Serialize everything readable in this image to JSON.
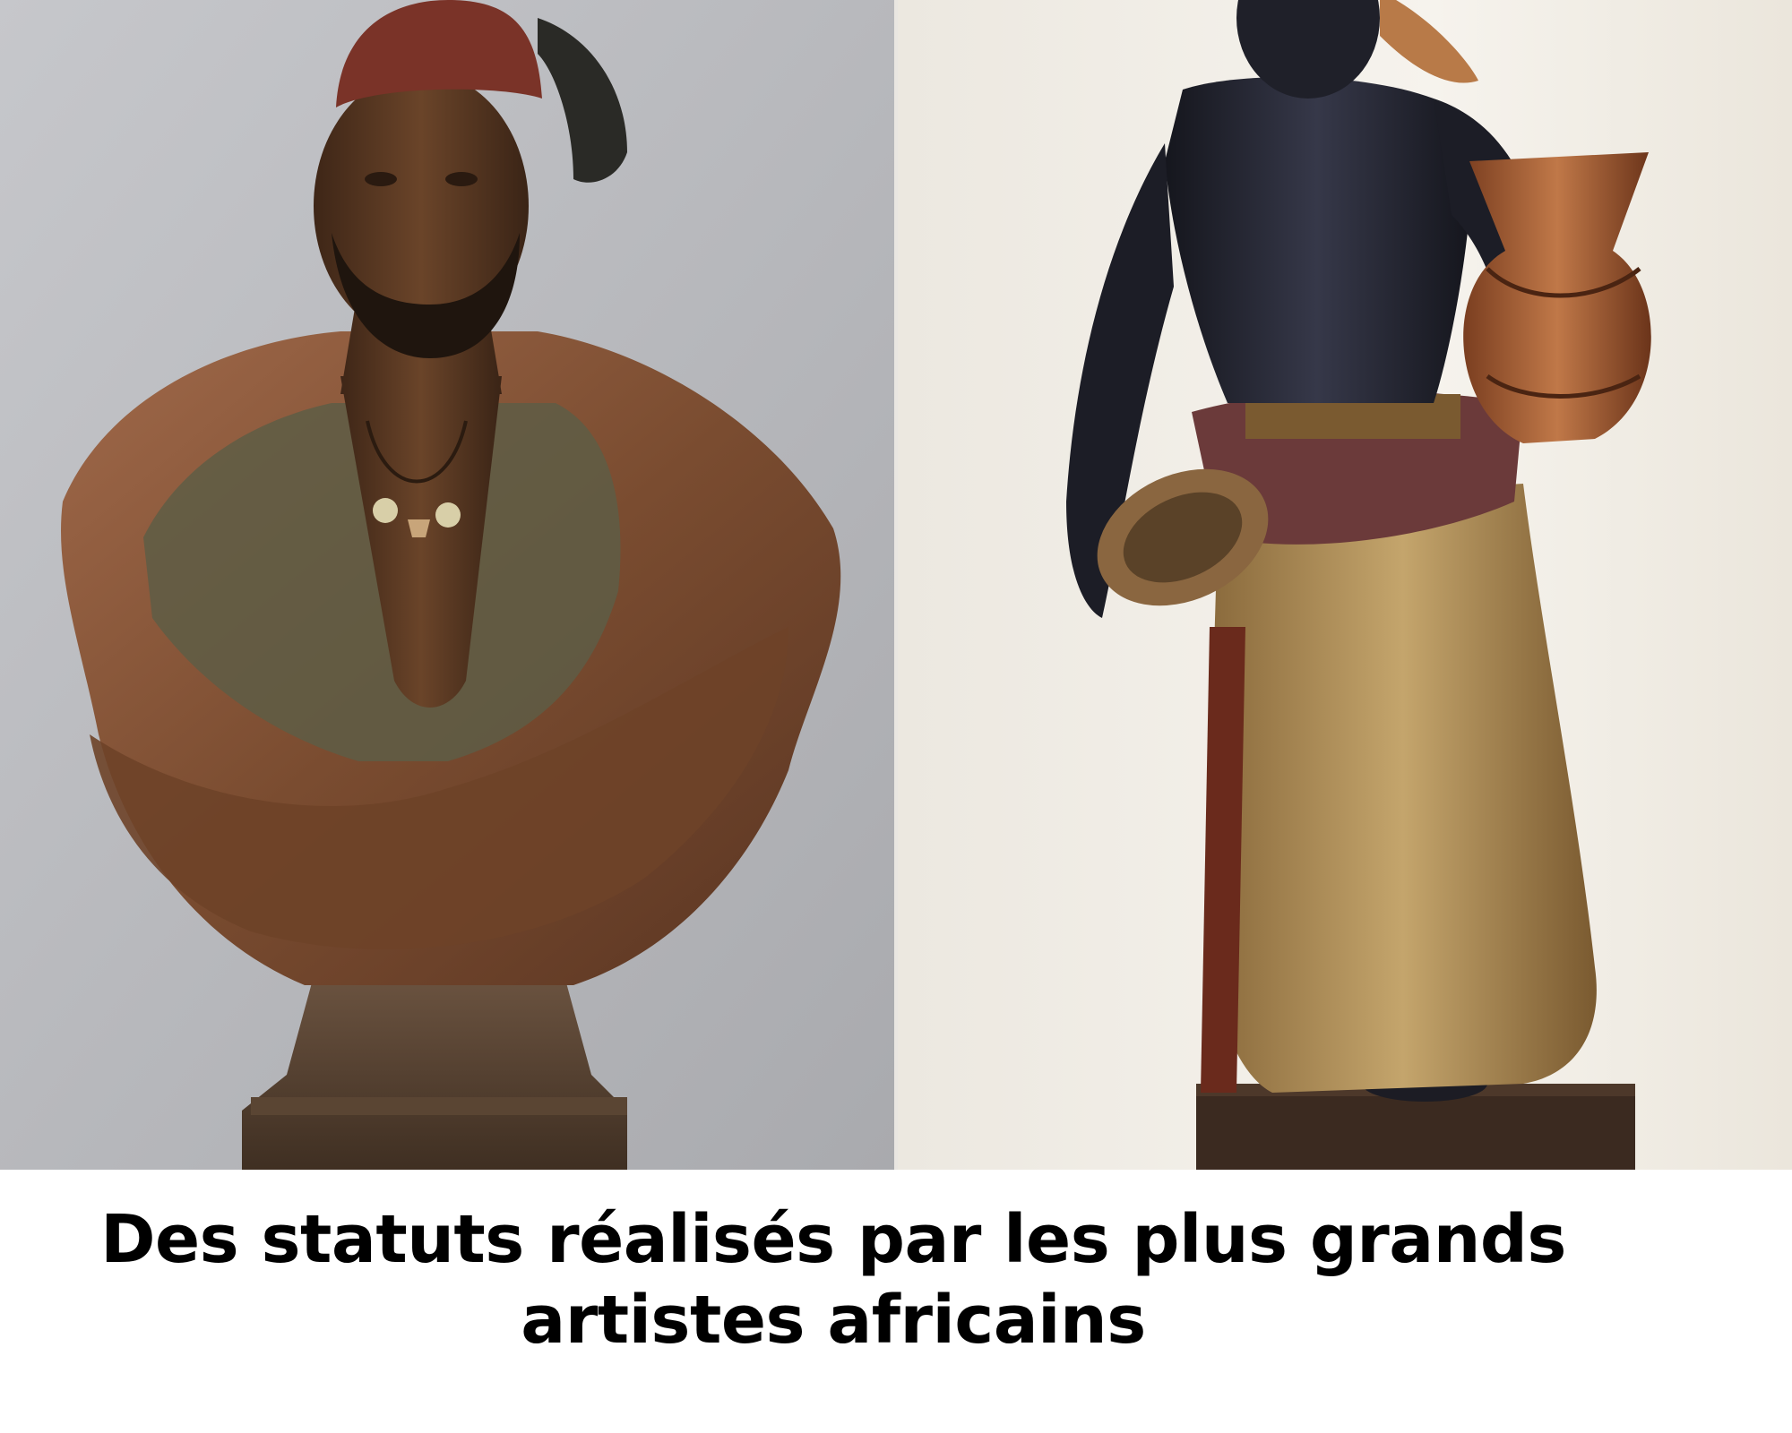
{
  "caption": {
    "text": "Des statuts réalisés par les plus grands artistes africains"
  },
  "photos": [
    {
      "icon": "bust-sculpture-icon",
      "background": "#b9babe"
    },
    {
      "icon": "standing-figure-sculpture-icon",
      "background": "#f2eee6"
    }
  ],
  "colors": {
    "bronze_skin": "#5c3a24",
    "dark_skin": "#232430",
    "fez_red": "#7a3328",
    "copper_drape": "#8b5a3a",
    "olive_vest": "#5e5d45",
    "gold_cloth": "#b08a4c",
    "caption_text": "#000000"
  }
}
